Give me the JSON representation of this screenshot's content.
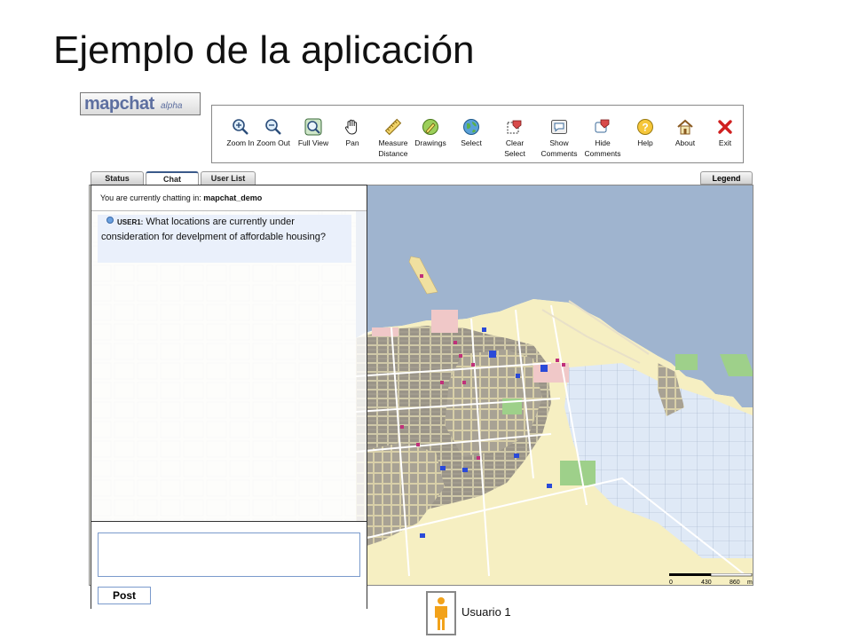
{
  "slide": {
    "title": "Ejemplo de la aplicación"
  },
  "logo": {
    "main": "mapchat",
    "sub": "alpha"
  },
  "toolbar": {
    "buttons": [
      {
        "label": "Zoom In",
        "icon": "zoom-in-icon"
      },
      {
        "label": "Zoom Out",
        "icon": "zoom-out-icon"
      },
      {
        "label": "Full View",
        "icon": "full-view-icon"
      },
      {
        "label": "Pan",
        "icon": "pan-hand-icon"
      },
      {
        "label": "Measure\nDistance",
        "icon": "ruler-icon"
      },
      {
        "label": "Drawings",
        "icon": "drawings-icon"
      },
      {
        "label": "Select",
        "icon": "select-globe-icon"
      },
      {
        "label": "Clear\nSelect",
        "icon": "clear-select-icon"
      },
      {
        "label": "Show\nComments",
        "icon": "show-comments-icon"
      },
      {
        "label": "Hide\nComments",
        "icon": "hide-comments-icon"
      },
      {
        "label": "Help",
        "icon": "help-icon"
      },
      {
        "label": "About",
        "icon": "home-icon"
      },
      {
        "label": "Exit",
        "icon": "exit-icon"
      }
    ]
  },
  "tabs": [
    {
      "label": "Status"
    },
    {
      "label": "Chat",
      "active": true
    },
    {
      "label": "User List"
    }
  ],
  "legend_tab": "Legend",
  "chat": {
    "header_prefix": "You are currently chatting in:",
    "room": "mapchat_demo",
    "messages": [
      {
        "user": "USER1:",
        "text": "What locations are currently under consideration for develpment of affordable housing?"
      }
    ],
    "input_value": "",
    "post_label": "Post"
  },
  "scale": {
    "labels": [
      "0",
      "430",
      "860"
    ],
    "unit": "m"
  },
  "user": {
    "name": "Usuario 1"
  },
  "colors": {
    "water": "#9fb4cf",
    "land": "#f6efc2",
    "accent": "#3a5a8a"
  }
}
